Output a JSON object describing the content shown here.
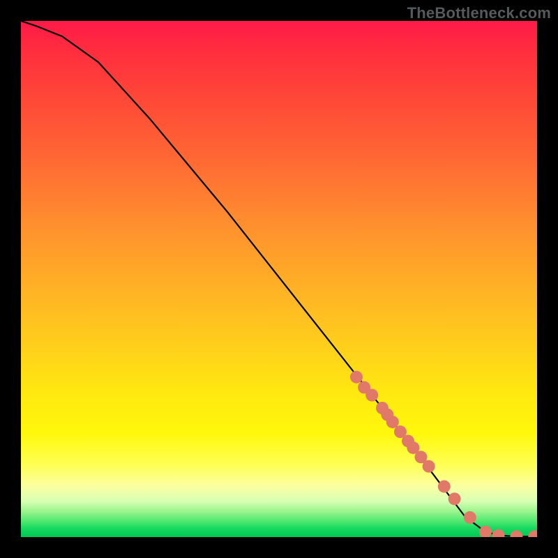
{
  "watermark": "TheBottleneck.com",
  "chart_data": {
    "type": "line",
    "title": "",
    "xlabel": "",
    "ylabel": "",
    "xlim": [
      0,
      100
    ],
    "ylim": [
      0,
      100
    ],
    "series": [
      {
        "name": "curve",
        "x": [
          0,
          3,
          8,
          15,
          25,
          40,
          55,
          70,
          80,
          86,
          90,
          93,
          96,
          100
        ],
        "values": [
          100,
          99,
          97,
          92,
          81,
          63,
          44,
          25,
          12,
          4,
          1,
          0.3,
          0.1,
          0.1
        ]
      }
    ],
    "markers": {
      "name": "highlight-points",
      "color": "#e17968",
      "x": [
        65,
        66.5,
        68,
        70,
        71,
        72,
        73.5,
        75,
        76,
        77.5,
        79,
        82,
        84,
        87,
        90,
        92.5,
        96,
        99.5
      ],
      "values": [
        31,
        29,
        27.5,
        25,
        23.7,
        22.3,
        20.4,
        18.6,
        17.3,
        15.5,
        13.7,
        9.8,
        7.4,
        3.8,
        1.0,
        0.3,
        0.1,
        0.1
      ]
    },
    "gradient_stops": [
      {
        "pos": 0.0,
        "color": "#ff1a48"
      },
      {
        "pos": 0.14,
        "color": "#ff4538"
      },
      {
        "pos": 0.38,
        "color": "#ff8b2f"
      },
      {
        "pos": 0.64,
        "color": "#ffd21a"
      },
      {
        "pos": 0.8,
        "color": "#fff80c"
      },
      {
        "pos": 0.9,
        "color": "#fcffa0"
      },
      {
        "pos": 0.95,
        "color": "#9bf58e"
      },
      {
        "pos": 1.0,
        "color": "#00c853"
      }
    ]
  }
}
